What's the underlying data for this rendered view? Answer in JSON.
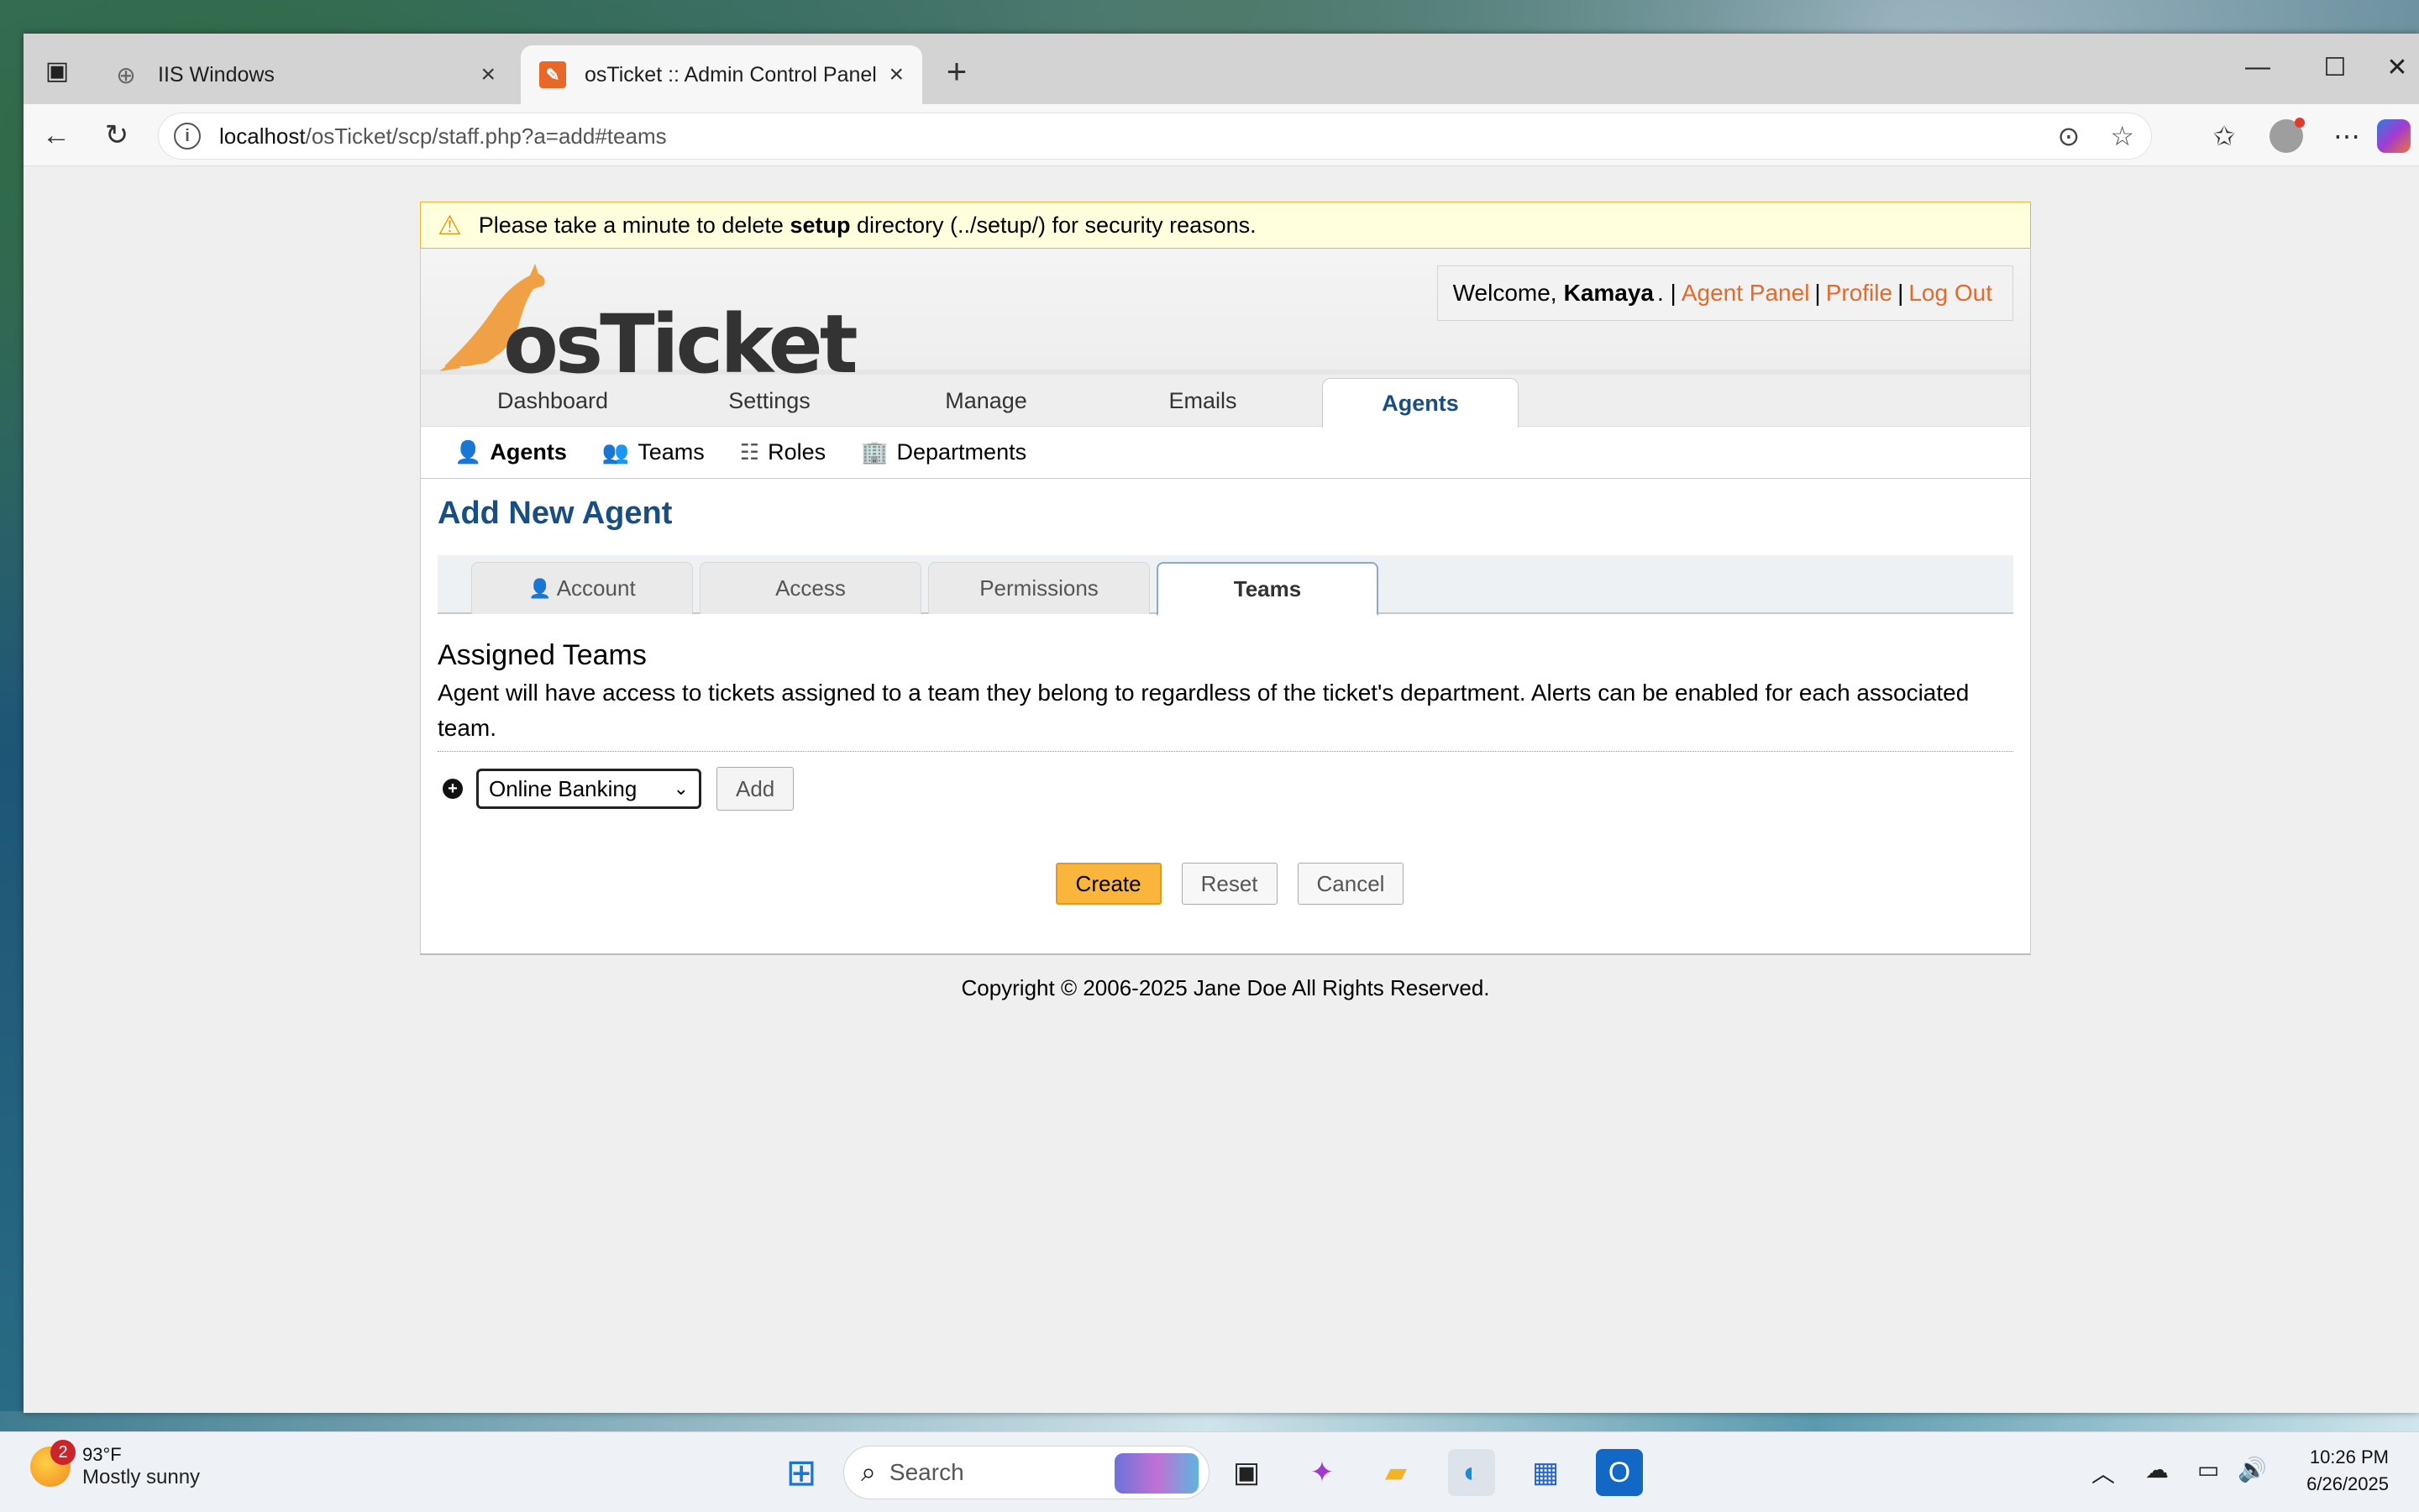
{
  "browser": {
    "tabs": [
      {
        "title": "IIS Windows",
        "active": false
      },
      {
        "title": "osTicket :: Admin Control Panel",
        "active": true
      }
    ],
    "address": {
      "host": "localhost",
      "path": "/osTicket/scp/staff.php?a=add#teams"
    }
  },
  "notice": {
    "prefix": "Please take a minute to delete",
    "bold": "setup",
    "suffix": "directory (../setup/) for security reasons."
  },
  "header": {
    "logo_text": "osTicket",
    "welcome_prefix": "Welcome,",
    "user_name": "Kamaya",
    "sep_after_user": ". |",
    "sep": "|",
    "links": {
      "agent_panel": "Agent Panel",
      "profile": "Profile",
      "logout": "Log Out"
    }
  },
  "nav": {
    "items": [
      "Dashboard",
      "Settings",
      "Manage",
      "Emails",
      "Agents"
    ],
    "active": "Agents"
  },
  "subnav": {
    "items": [
      "Agents",
      "Teams",
      "Roles",
      "Departments"
    ],
    "active": "Agents"
  },
  "page": {
    "title": "Add New Agent",
    "tabs": [
      "Account",
      "Access",
      "Permissions",
      "Teams"
    ],
    "active_tab": "Teams",
    "section_title": "Assigned Teams",
    "description": "Agent will have access to tickets assigned to a team they belong to regardless of the ticket's department. Alerts can be enabled for each associated team.",
    "team_select_value": "Online Banking",
    "add_label": "Add",
    "create_label": "Create",
    "reset_label": "Reset",
    "cancel_label": "Cancel"
  },
  "footer": {
    "text": "Copyright © 2006-2025 Jane Doe All Rights Reserved."
  },
  "taskbar": {
    "weather_badge": "2",
    "temperature": "93°F",
    "condition": "Mostly sunny",
    "search_placeholder": "Search",
    "time": "10:26 PM",
    "date": "6/26/2025"
  },
  "colors": {
    "link": "#e46a2c",
    "title_blue": "#184e81",
    "primary_button": "#f9b53c",
    "notice_bg": "#ffffdd"
  }
}
